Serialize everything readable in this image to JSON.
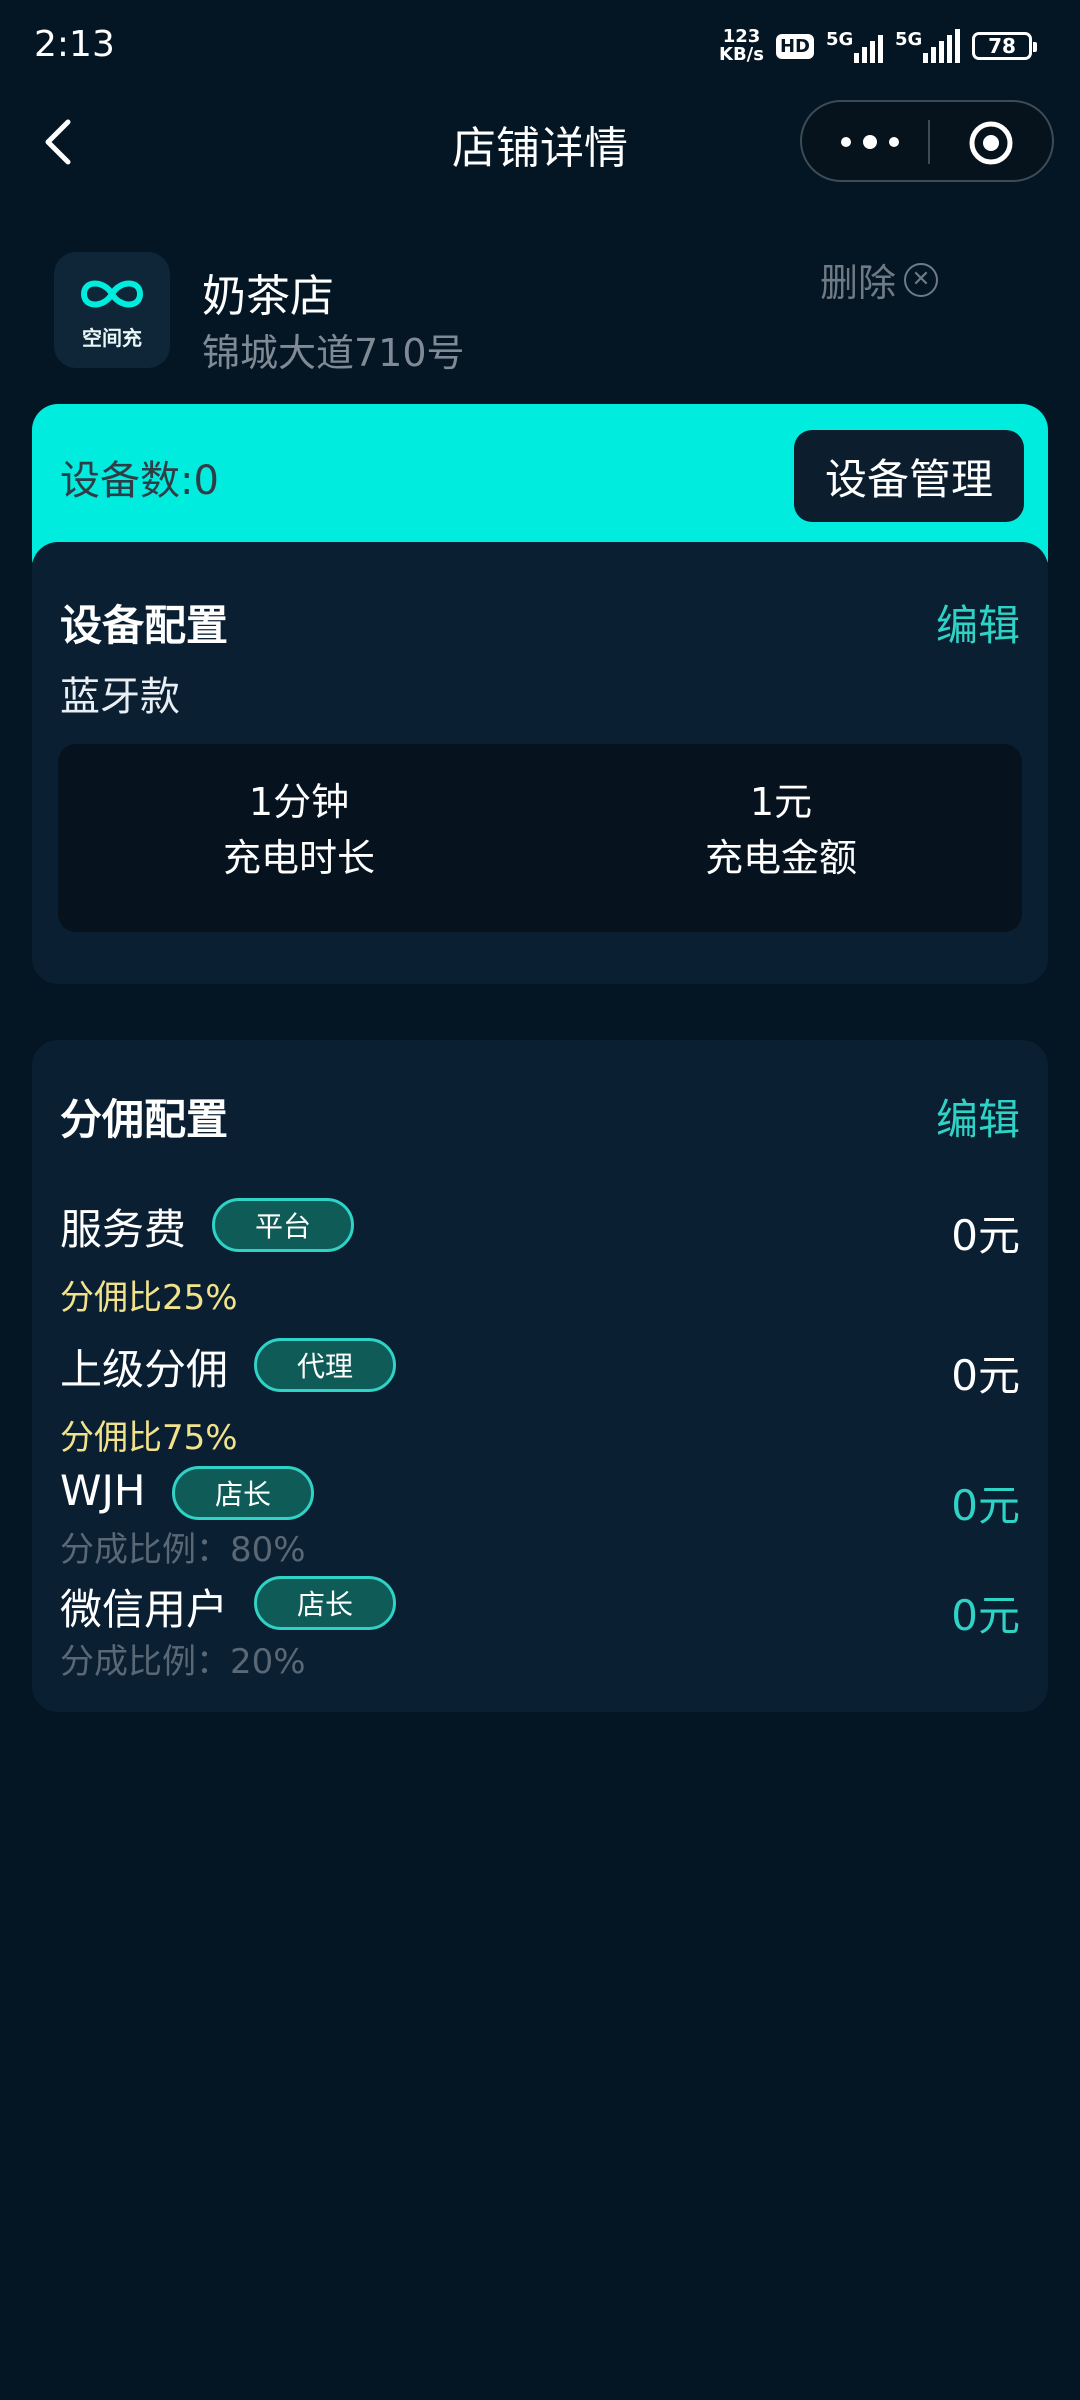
{
  "status_bar": {
    "time": "2:13",
    "net_speed_value": "123",
    "net_speed_unit": "KB/s",
    "hd": "HD",
    "sim1": "5G",
    "sim2": "5G",
    "battery": "78"
  },
  "nav": {
    "title": "店铺详情"
  },
  "shop": {
    "logo_text": "空间充",
    "name": "奶茶店",
    "address": "锦城大道710号",
    "delete_label": "删除"
  },
  "devices": {
    "count_label": "设备数:0",
    "manage_button": "设备管理"
  },
  "device_config": {
    "title": "设备配置",
    "edit_label": "编辑",
    "type": "蓝牙款",
    "duration_value": "1分钟",
    "duration_label": "充电时长",
    "amount_value": "1元",
    "amount_label": "充电金额"
  },
  "split_config": {
    "title": "分佣配置",
    "edit_label": "编辑",
    "rows": [
      {
        "label": "服务费",
        "tag": "平台",
        "amount": "0元",
        "ratio": "分佣比25%"
      },
      {
        "label": "上级分佣",
        "tag": "代理",
        "amount": "0元",
        "ratio": "分佣比75%"
      },
      {
        "label": "WJH",
        "tag": "店长",
        "amount": "0元",
        "ratio": "分成比例：80%"
      },
      {
        "label": "微信用户",
        "tag": "店长",
        "amount": "0元",
        "ratio": "分成比例：20%"
      }
    ]
  },
  "colors": {
    "background": "#041623",
    "accent": "#00ecdf",
    "accent_text": "#2fd3c6",
    "card": "#0a1f32",
    "ratio_yellow": "#f2e28c"
  },
  "icons": [
    "back-arrow-icon",
    "more-dots-icon",
    "target-icon",
    "close-circle-icon",
    "app-logo-icon"
  ]
}
